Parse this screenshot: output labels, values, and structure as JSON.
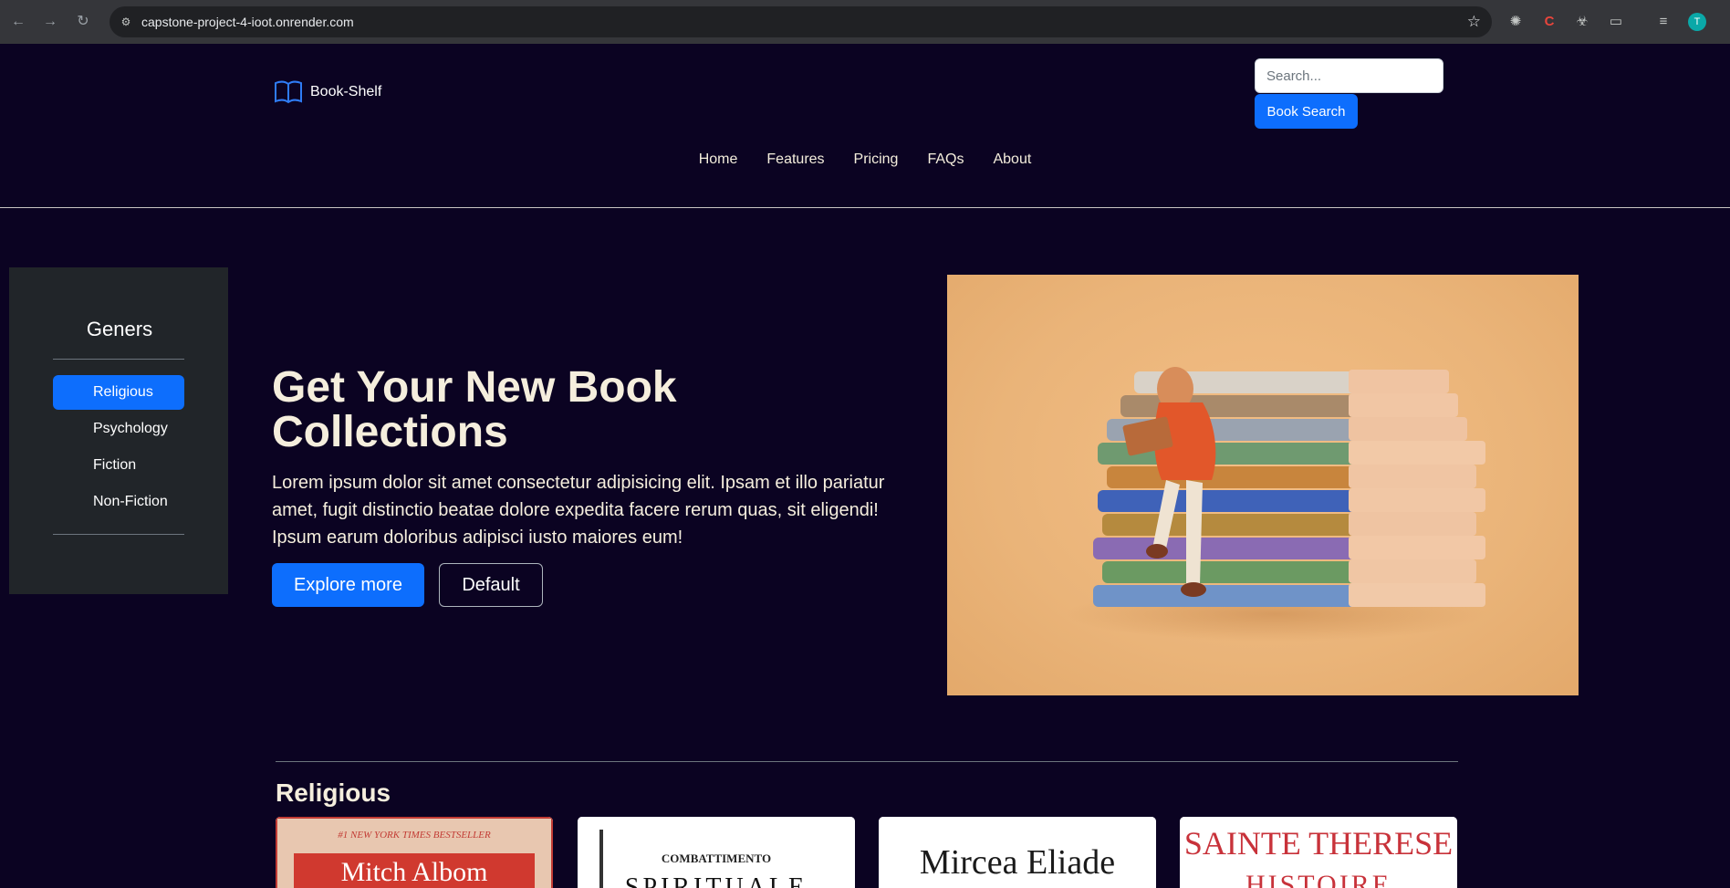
{
  "browser": {
    "url": "capstone-project-4-ioot.onrender.com",
    "profile_initial": "T"
  },
  "header": {
    "brand": "Book-Shelf",
    "search_placeholder": "Search...",
    "search_button": "Book Search",
    "nav": [
      "Home",
      "Features",
      "Pricing",
      "FAQs",
      "About"
    ]
  },
  "sidebar": {
    "title": "Geners",
    "items": [
      "Religious",
      "Psychology",
      "Fiction",
      "Non-Fiction"
    ],
    "active": "Religious"
  },
  "hero": {
    "title": "Get Your New Book Collections",
    "text": "Lorem ipsum dolor sit amet consectetur adipisicing elit. Ipsam et illo pariatur amet, fugit distinctio beatae dolore expedita facere rerum quas, sit eligendi! Ipsum earum doloribus adipisci iusto maiores eum!",
    "primary_button": "Explore more",
    "secondary_button": "Default"
  },
  "section": {
    "title": "Religious",
    "books": [
      {
        "top_line": "#1 NEW YORK TIMES BESTSELLER",
        "author": "Mitch Albom"
      },
      {
        "top_line": "COMBATTIMENTO",
        "author": "SPIRITUALE"
      },
      {
        "top_line": "",
        "author": "Mircea Eliade"
      },
      {
        "top_line": "SAINTE THERESE",
        "author": "HISTOIRE"
      }
    ]
  },
  "colors": {
    "page_bg": "#0b0322",
    "accent": "#0d6efd",
    "sidebar_bg": "#212529",
    "hero_text": "#f5eedd"
  }
}
